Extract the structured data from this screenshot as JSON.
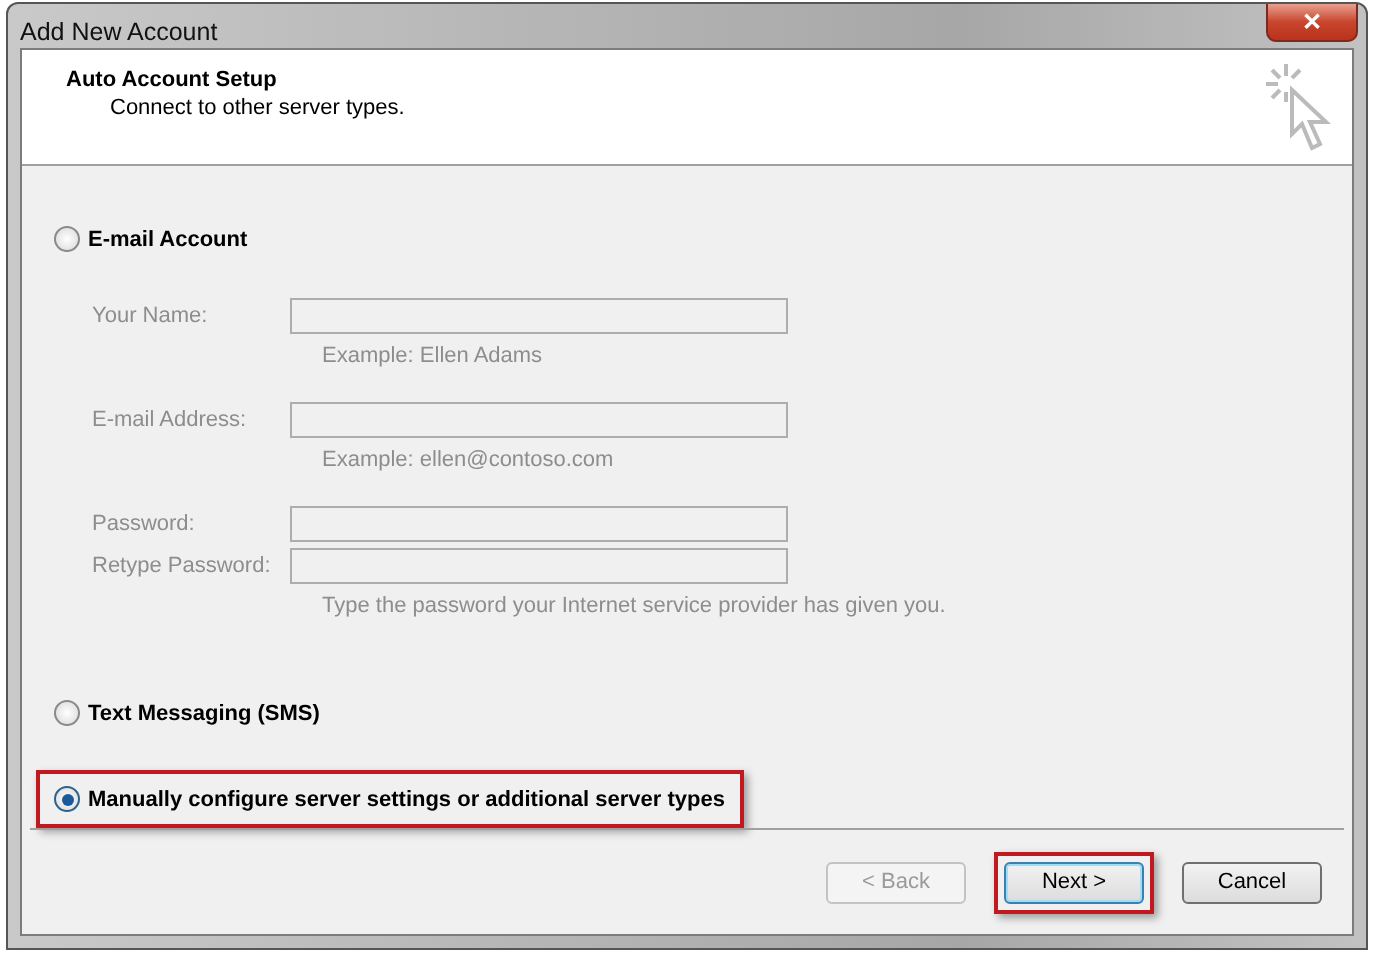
{
  "window": {
    "title": "Add New Account",
    "close": "✕"
  },
  "header": {
    "title": "Auto Account Setup",
    "subtitle": "Connect to other server types."
  },
  "options": [
    {
      "kind": "section",
      "label": "E-mail Account",
      "selected": false,
      "highlighted": false,
      "fields": [
        {
          "label": "Your Name:",
          "disabled": true,
          "hint": "Example: Ellen Adams"
        },
        {
          "label": "E-mail Address:",
          "disabled": true,
          "hint": "Example: ellen@contoso.com"
        },
        {
          "label": "Password:",
          "disabled": true
        },
        {
          "label": "Retype Password:",
          "disabled": true,
          "hint": "Type the password your Internet service provider has given you."
        }
      ]
    },
    {
      "kind": "plain",
      "label": "Text Messaging (SMS)",
      "selected": false,
      "highlighted": false
    },
    {
      "kind": "plain",
      "label": "Manually configure server settings or additional server types",
      "selected": true,
      "highlighted": true
    }
  ],
  "buttons": [
    {
      "label": "< Back",
      "disabled": true,
      "default": false,
      "highlighted": false
    },
    {
      "label": "Next >",
      "disabled": false,
      "default": true,
      "highlighted": true
    },
    {
      "label": "Cancel",
      "disabled": false,
      "default": false,
      "highlighted": false
    }
  ]
}
